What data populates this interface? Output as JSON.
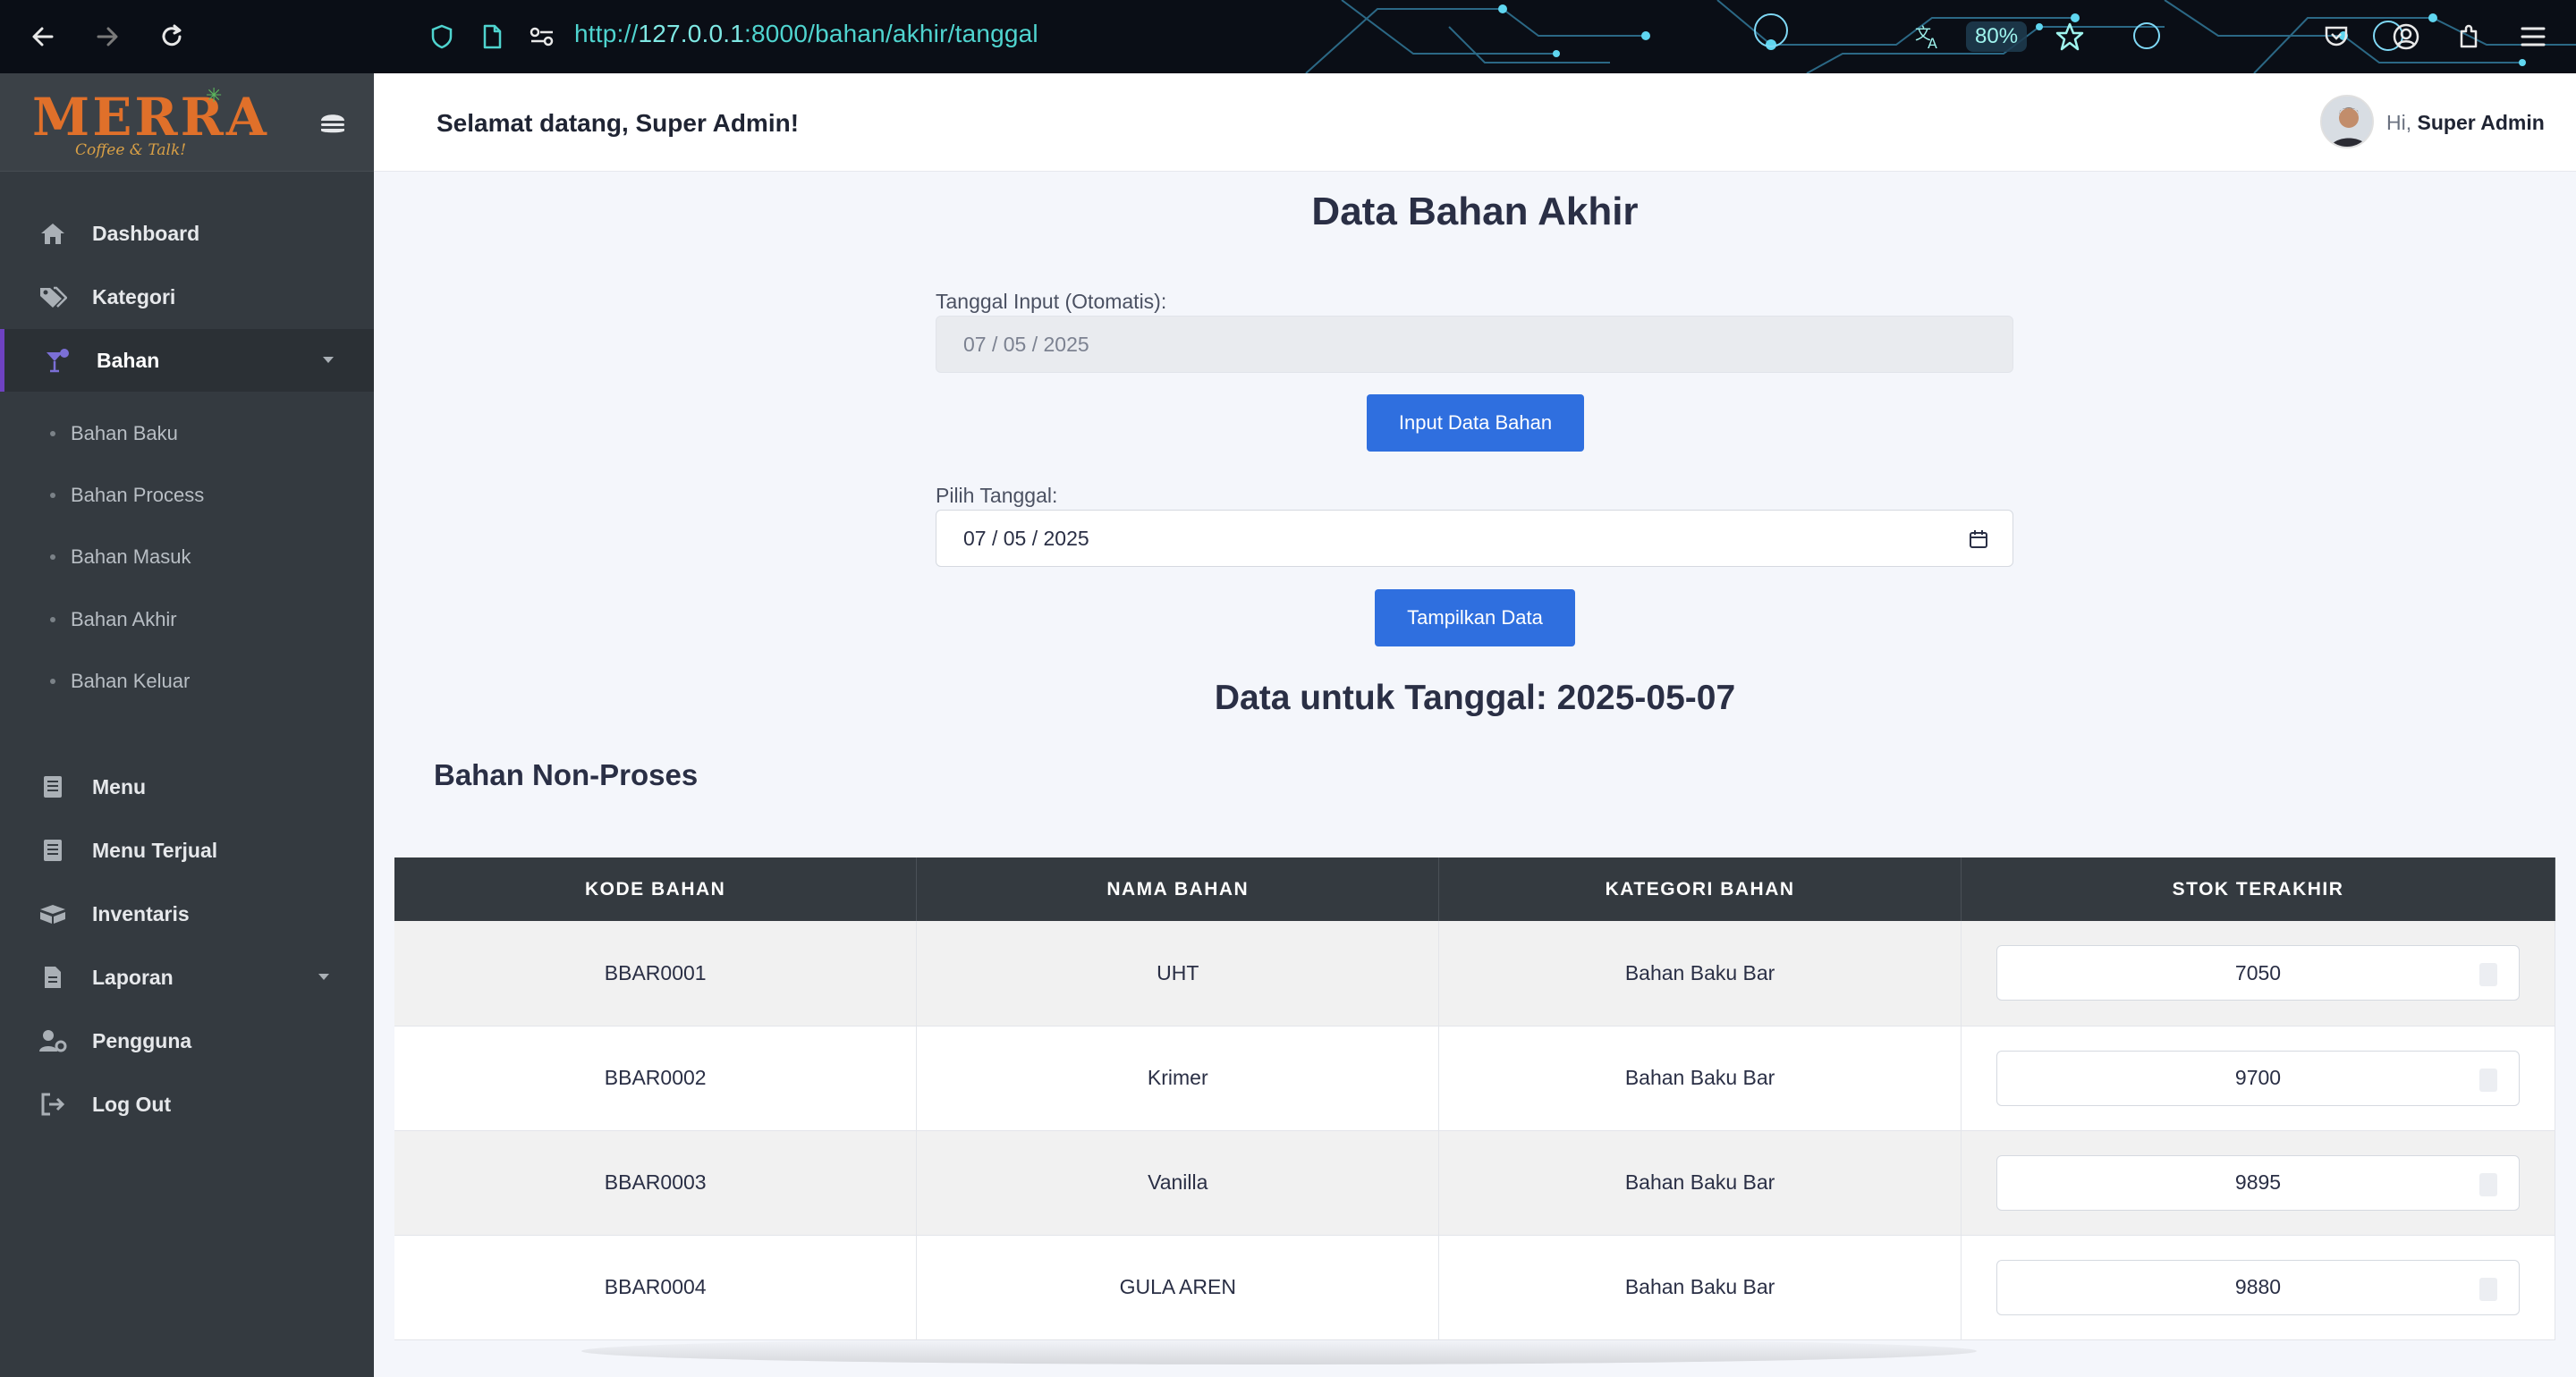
{
  "browser": {
    "url_scheme": "http://",
    "url_host": "127.0.0.1",
    "url_rest": ":8000/bahan/akhir/tanggal",
    "zoom": "80%",
    "icons": [
      "back-arrow-icon",
      "forward-arrow-icon",
      "reload-icon",
      "shield-icon",
      "page-icon",
      "site-settings-icon",
      "translate-icon",
      "star-icon",
      "pocket-icon",
      "account-icon",
      "extensions-icon",
      "hamburger-menu-icon"
    ]
  },
  "brand": {
    "name": "MERRA",
    "tagline": "Coffee & Talk!",
    "accent": "#e0702a"
  },
  "sidebar": {
    "items": [
      {
        "label": "Dashboard",
        "icon": "home-icon"
      },
      {
        "label": "Kategori",
        "icon": "tags-icon"
      },
      {
        "label": "Bahan",
        "icon": "cocktail-icon",
        "active": true,
        "expandable": true
      },
      {
        "label": "Menu",
        "icon": "list-icon"
      },
      {
        "label": "Menu Terjual",
        "icon": "list-icon"
      },
      {
        "label": "Inventaris",
        "icon": "boxes-icon"
      },
      {
        "label": "Laporan",
        "icon": "file-icon",
        "expandable": true
      },
      {
        "label": "Pengguna",
        "icon": "user-gear-icon"
      },
      {
        "label": "Log Out",
        "icon": "logout-icon"
      }
    ],
    "sub_items": [
      "Bahan Baku",
      "Bahan Process",
      "Bahan Masuk",
      "Bahan Akhir",
      "Bahan Keluar"
    ]
  },
  "header": {
    "welcome": "Selamat datang, Super Admin!",
    "greet_prefix": "Hi, ",
    "user_name": "Super Admin"
  },
  "main": {
    "title": "Data Bahan Akhir",
    "input_label": "Tanggal Input (Otomatis):",
    "input_value": "07 / 05 / 2025",
    "input_button": "Input Data Bahan",
    "pick_label": "Pilih Tanggal:",
    "pick_value": "07 / 05 / 2025",
    "show_button": "Tampilkan Data",
    "data_heading": "Data untuk Tanggal: 2025-05-07",
    "section": "Bahan Non-Proses",
    "accent_button": "#2f6fdf"
  },
  "table": {
    "columns": [
      "KODE BAHAN",
      "NAMA BAHAN",
      "KATEGORI BAHAN",
      "STOK TERAKHIR"
    ],
    "rows": [
      {
        "kode": "BBAR0001",
        "nama": "UHT",
        "kategori": "Bahan Baku Bar",
        "stok": "7050"
      },
      {
        "kode": "BBAR0002",
        "nama": "Krimer",
        "kategori": "Bahan Baku Bar",
        "stok": "9700"
      },
      {
        "kode": "BBAR0003",
        "nama": "Vanilla",
        "kategori": "Bahan Baku Bar",
        "stok": "9895"
      },
      {
        "kode": "BBAR0004",
        "nama": "GULA AREN",
        "kategori": "Bahan Baku Bar",
        "stok": "9880"
      }
    ]
  }
}
